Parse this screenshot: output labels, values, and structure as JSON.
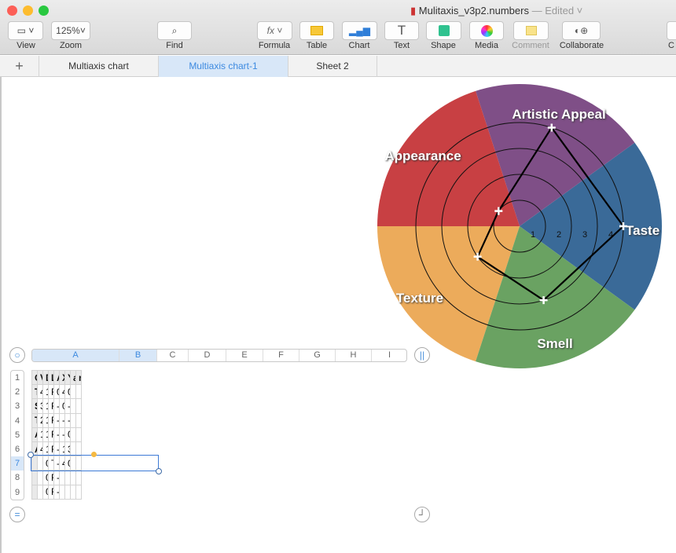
{
  "window": {
    "title": "Mulitaxis_v3p2.numbers",
    "status": "— Edited ˅"
  },
  "toolbar": {
    "view": "View",
    "zoom": "Zoom",
    "zoom_value": "125%",
    "find": "Find",
    "formula": "Formula",
    "table": "Table",
    "chart": "Chart",
    "text": "Text",
    "shape": "Shape",
    "media": "Media",
    "comment": "Comment",
    "collaborate": "Collaborate",
    "cut_off": "C"
  },
  "sheets": [
    {
      "label": "Multiaxis chart"
    },
    {
      "label": "Multiaxis chart-1",
      "active": true
    },
    {
      "label": "Sheet 2"
    }
  ],
  "add_sheet": "+",
  "table": {
    "columns": [
      "A",
      "B",
      "C",
      "D",
      "E",
      "F",
      "G",
      "H",
      "I"
    ],
    "rows": [
      "1",
      "2",
      "3",
      "4",
      "5",
      "6",
      "7",
      "8",
      "9"
    ],
    "headers": [
      "Category",
      "Value",
      "Draw",
      "Last",
      "Angle",
      "X",
      "Y",
      "angle",
      "radius"
    ],
    "data": [
      [
        "Taste",
        "4",
        "1",
        "FALSE",
        "0",
        "4",
        "0",
        "",
        ""
      ],
      [
        "Smell",
        "3",
        "1",
        "FALSE",
        "-1.2566",
        "0.92705",
        "-2.8531",
        "",
        ""
      ],
      [
        "Texture",
        "2",
        "1",
        "FALSE",
        "-2.5132",
        "-1.6180",
        "-1.1755",
        "",
        ""
      ],
      [
        "Appearance",
        "1",
        "1",
        "FALSE",
        "-3.7699",
        "-0.8090",
        "0.58778",
        "",
        ""
      ],
      [
        "Artistic Appeal",
        "4",
        "1",
        "FALSE",
        "-5.0265",
        "1.23606",
        "3.80422",
        "",
        ""
      ],
      [
        "",
        "",
        "0",
        "TRUE",
        "-6.2831",
        "4",
        "0.00000",
        "",
        ""
      ],
      [
        "",
        "",
        "0",
        "FALSE",
        "-7.5398",
        "",
        "",
        "",
        ""
      ],
      [
        "",
        "",
        "0",
        "FALSE",
        "-8.7964",
        "",
        "",
        "",
        ""
      ]
    ]
  },
  "chart_data": {
    "type": "radar",
    "categories": [
      "Taste",
      "Artistic Appeal",
      "Appearance",
      "Texture",
      "Smell"
    ],
    "values": [
      4,
      4,
      1,
      2,
      3
    ],
    "colors": [
      "#3a6a98",
      "#7f4f87",
      "#c84043",
      "#ecab5b",
      "#6aa262"
    ],
    "ring_labels": [
      "1",
      "2",
      "3",
      "4"
    ],
    "rmax": 5.5
  }
}
